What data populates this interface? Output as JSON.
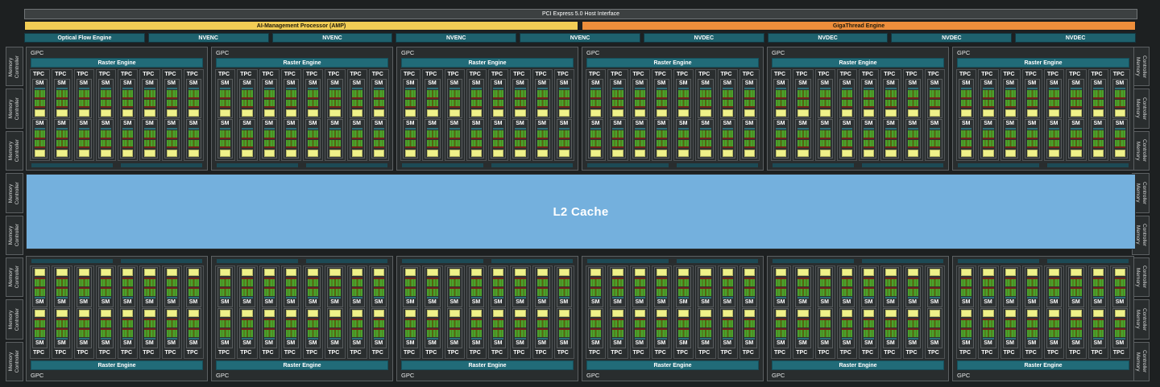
{
  "header": {
    "pci_label": "PCI Express 5.0 Host Interface",
    "amp_label": "AI-Management Processor (AMP)",
    "gigathread_label": "GigaThread Engine",
    "media_engines": [
      "Optical Flow Engine",
      "NVENC",
      "NVENC",
      "NVENC",
      "NVENC",
      "NVDEC",
      "NVDEC",
      "NVDEC",
      "NVDEC"
    ]
  },
  "memory_controller": {
    "label_line1": "Memory",
    "label_line2": "Controller",
    "count_left": 8,
    "count_right": 8
  },
  "l2_cache": {
    "label": "L2 Cache"
  },
  "gpc": {
    "label": "GPC",
    "raster_label": "Raster Engine",
    "tpc_label": "TPC",
    "sm_label": "SM",
    "top_count": 6,
    "bottom_count": 6,
    "tpcs_per_gpc": 8,
    "sms_per_tpc": 2,
    "foot_bars_per_gpc": 2
  },
  "colors": {
    "background": "#1d2021",
    "host_bar": "#3c4041",
    "amp_yellow": "#f2cd55",
    "gigathread_orange": "#ee8e3b",
    "media_teal": "#1e616d",
    "raster_teal": "#216b78",
    "sm_cache_teal": "#2b6e78",
    "foot_teal": "#1d4a55",
    "core_green": "#4aa22c",
    "core_olive": "#55630f",
    "core_maroon": "#71251b",
    "tensor_yellow": "#eff189",
    "l2_blue": "#74b0dd"
  }
}
